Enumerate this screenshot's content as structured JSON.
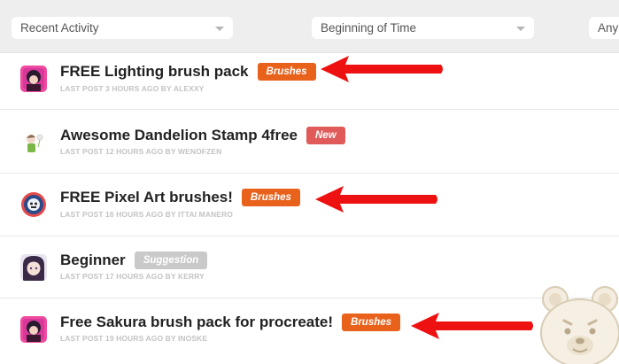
{
  "filters": {
    "sort": "Recent Activity",
    "time": "Beginning of Time",
    "third": "Any"
  },
  "threads": [
    {
      "title": "FREE Lighting brush pack",
      "tag": "Brushes",
      "tag_color": "#e8621c",
      "meta": "LAST POST 3 HOURS AGO BY ALEXXY"
    },
    {
      "title": "Awesome Dandelion Stamp 4free",
      "tag": "New",
      "tag_color": "#e05a5a",
      "meta": "LAST POST 12 HOURS AGO BY WENOFZEN"
    },
    {
      "title": "FREE Pixel Art brushes!",
      "tag": "Brushes",
      "tag_color": "#e8621c",
      "meta": "LAST POST 16 HOURS AGO BY ITTAI MANERO"
    },
    {
      "title": "Beginner",
      "tag": "Suggestion",
      "tag_color": "#c9c9c9",
      "meta": "LAST POST 17 HOURS AGO BY KERRY"
    },
    {
      "title": "Free Sakura brush pack for procreate!",
      "tag": "Brushes",
      "tag_color": "#e8621c",
      "meta": "LAST POST 19 HOURS AGO BY INOSKE"
    }
  ],
  "annotation_color": "#ee1111"
}
